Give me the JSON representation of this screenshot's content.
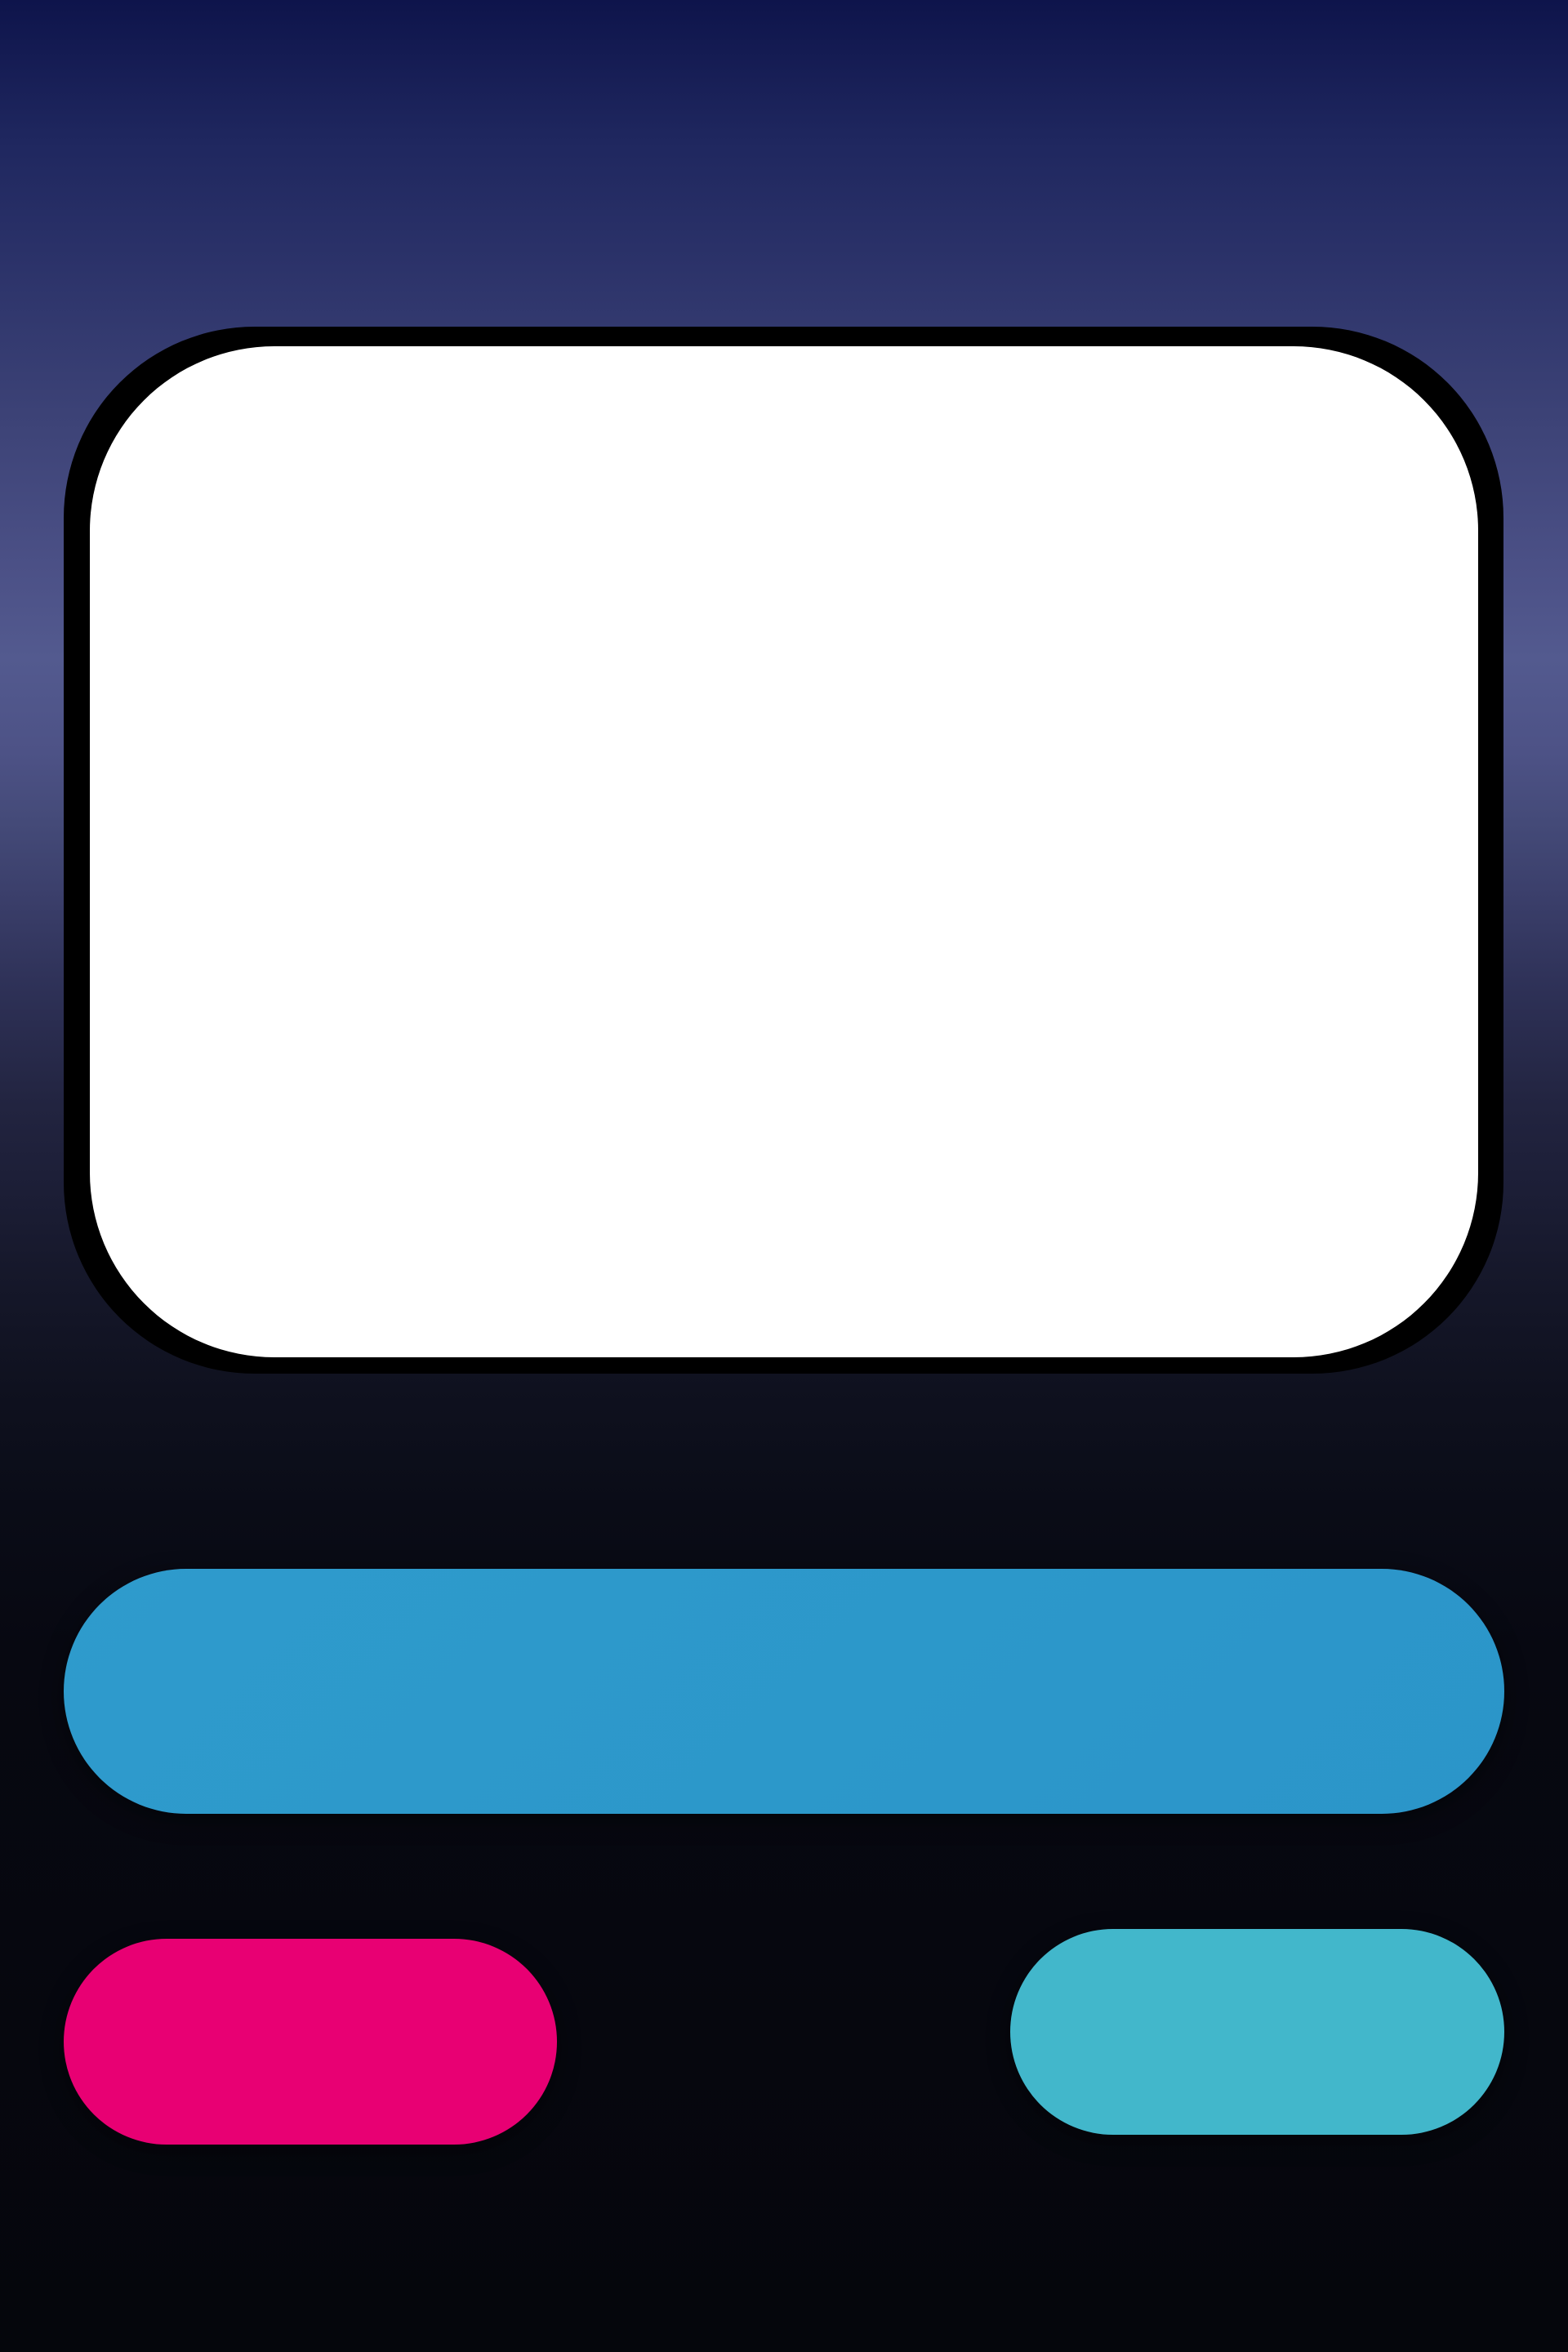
{
  "colors": {
    "background_top": "#0e144b",
    "background_mid": "#535a8f",
    "background_bottom": "#05060c",
    "screen_frame": "#000000",
    "screen_panel": "#ffffff",
    "primary_button": "#2d98cb",
    "left_button": "#e80073",
    "right_button": "#42b7cb"
  },
  "screen": {
    "content": ""
  },
  "buttons": {
    "primary_label": "",
    "left_label": "",
    "right_label": ""
  }
}
